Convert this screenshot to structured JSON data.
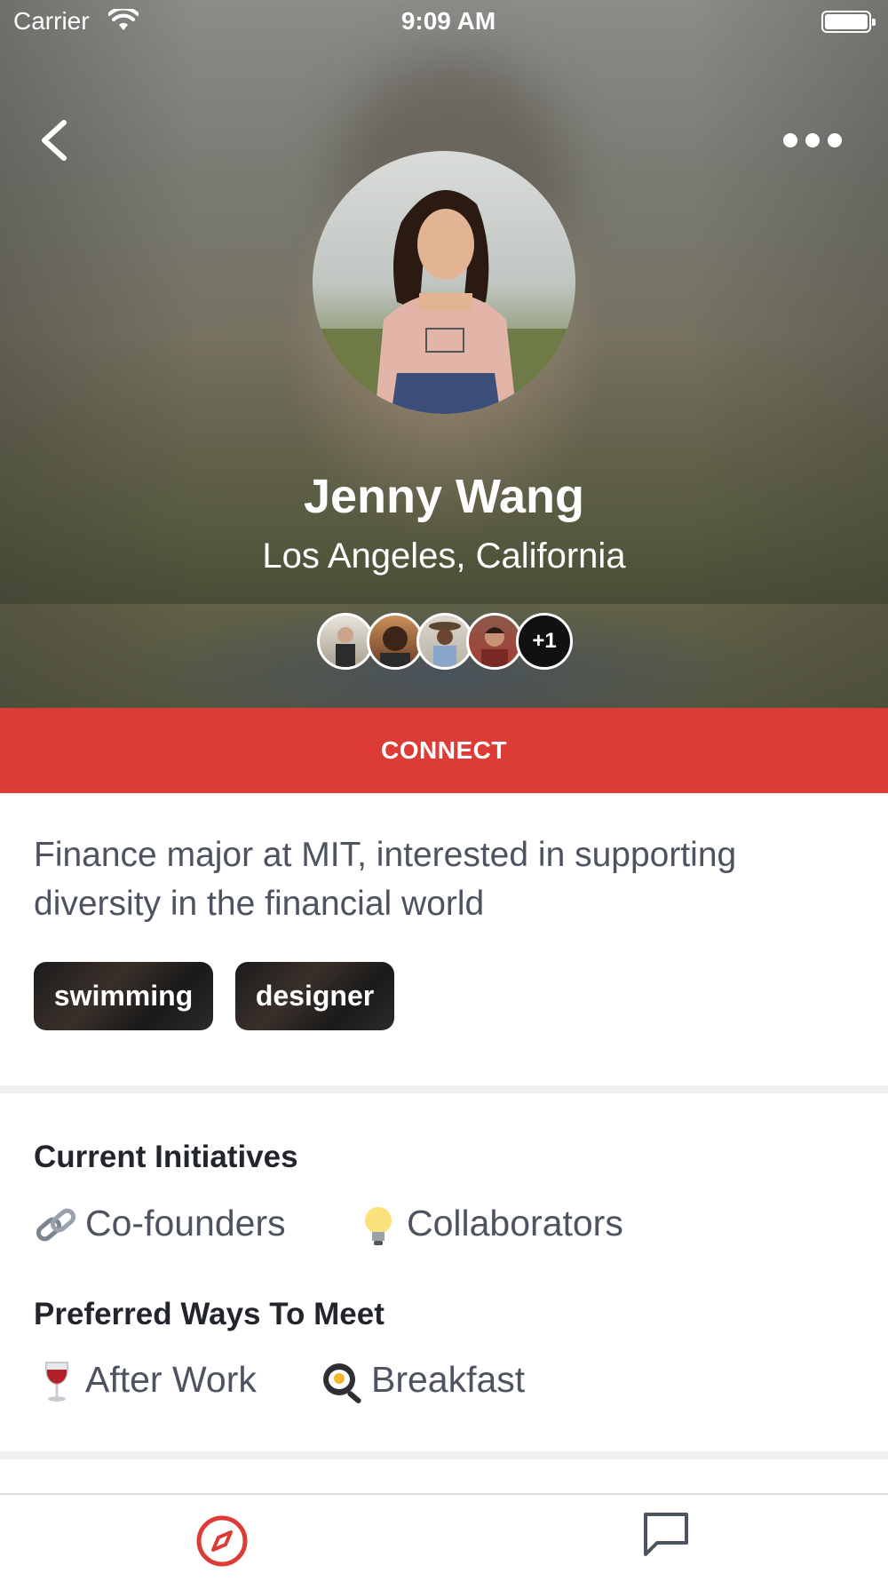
{
  "status_bar": {
    "carrier": "Carrier",
    "time": "9:09 AM"
  },
  "header": {
    "back_icon": "chevron-left-icon",
    "more_icon": "ellipsis-icon"
  },
  "profile": {
    "name": "Jenny Wang",
    "location": "Los Angeles, California",
    "mutual_connections_more": "+1"
  },
  "actions": {
    "connect_label": "CONNECT",
    "connect_color": "#dc3b36"
  },
  "bio": "Finance major at MIT, interested in supporting diversity in the financial world",
  "tags": [
    "swimming",
    "designer"
  ],
  "current_initiatives": {
    "title": "Current Initiatives",
    "items": [
      {
        "icon": "link-emoji-icon",
        "label": "Co-founders"
      },
      {
        "icon": "light-bulb-emoji-icon",
        "label": "Collaborators"
      }
    ]
  },
  "preferred_ways": {
    "title": "Preferred Ways To Meet",
    "items": [
      {
        "icon": "wine-glass-emoji-icon",
        "label": "After Work"
      },
      {
        "icon": "frying-pan-egg-emoji-icon",
        "label": "Breakfast"
      }
    ]
  },
  "tab_bar": {
    "tabs": [
      {
        "icon": "compass-icon",
        "active": true,
        "color": "#dc3b36"
      },
      {
        "icon": "chat-bubble-icon",
        "active": false,
        "color": "#4d5360"
      }
    ]
  }
}
